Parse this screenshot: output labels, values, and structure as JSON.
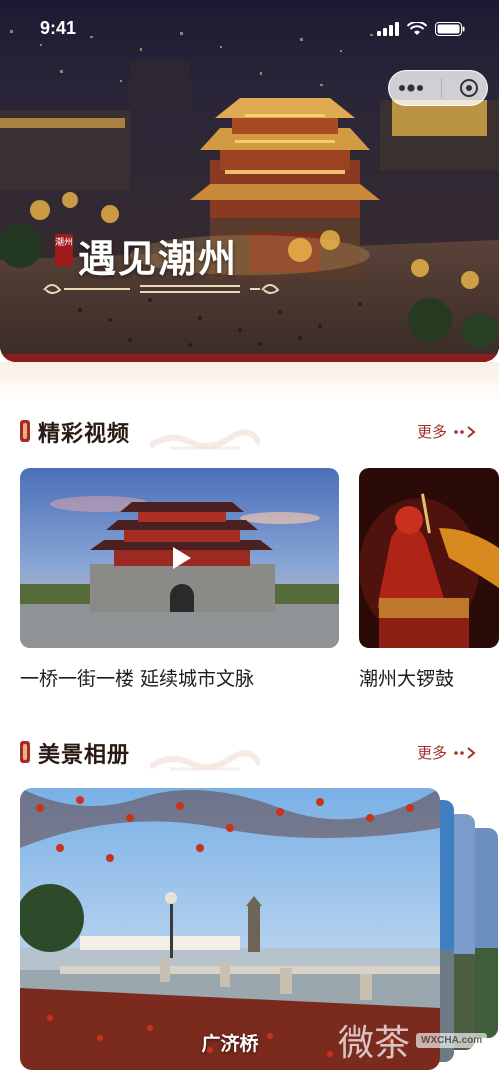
{
  "status": {
    "time": "9:41"
  },
  "hero": {
    "title": "遇见潮州",
    "seal_text": "潮州"
  },
  "sections": {
    "videos": {
      "title": "精彩视频",
      "more": "更多"
    },
    "album": {
      "title": "美景相册",
      "more": "更多"
    }
  },
  "videos": [
    {
      "label": "一桥一街一楼 延续城市文脉"
    },
    {
      "label": "潮州大锣鼓"
    }
  ],
  "album": {
    "caption": "广济桥"
  },
  "watermark": {
    "text": "微茶",
    "badge": "WXCHA.com"
  },
  "colors": {
    "accent": "#a3312a",
    "title": "#2a1a14"
  }
}
